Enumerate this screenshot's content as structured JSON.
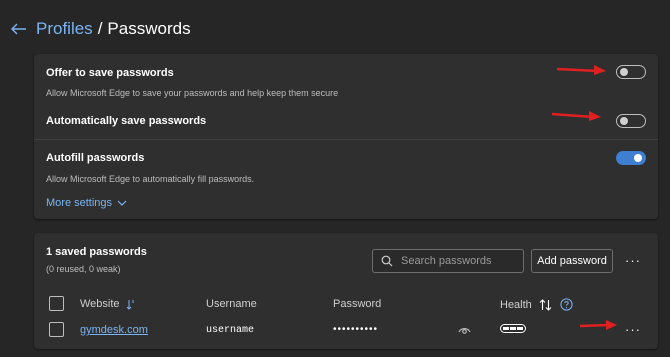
{
  "header": {
    "parent_crumb": "Profiles",
    "separator": "/",
    "current_crumb": "Passwords"
  },
  "settings": {
    "offer_save": {
      "title": "Offer to save passwords",
      "description": "Allow Microsoft Edge to save your passwords and help keep them secure",
      "enabled": false
    },
    "auto_save": {
      "title": "Automatically save passwords",
      "enabled": false
    },
    "autofill": {
      "title": "Autofill passwords",
      "description": "Allow Microsoft Edge to automatically fill passwords.",
      "enabled": true
    },
    "more_settings_label": "More settings"
  },
  "saved": {
    "title": "1 saved passwords",
    "subtitle": "(0 reused, 0 weak)",
    "search_placeholder": "Search passwords",
    "add_button_label": "Add password",
    "more_label": "···",
    "columns": {
      "website": "Website",
      "username": "Username",
      "password": "Password",
      "health": "Health"
    },
    "rows": [
      {
        "website": "gymdesk.com",
        "username": "username",
        "password": "••••••••••"
      }
    ]
  },
  "colors": {
    "accent": "#7ab4f2",
    "toggle_on": "#3f7fd1",
    "annotation_arrow": "#e02020",
    "background": "#262626",
    "card": "#2f2f2f"
  },
  "icons": [
    "back-arrow-icon",
    "chevron-down-icon",
    "search-icon",
    "sort-icon",
    "question-icon",
    "eye-icon",
    "health-strength-icon",
    "red-arrow-annotation"
  ]
}
